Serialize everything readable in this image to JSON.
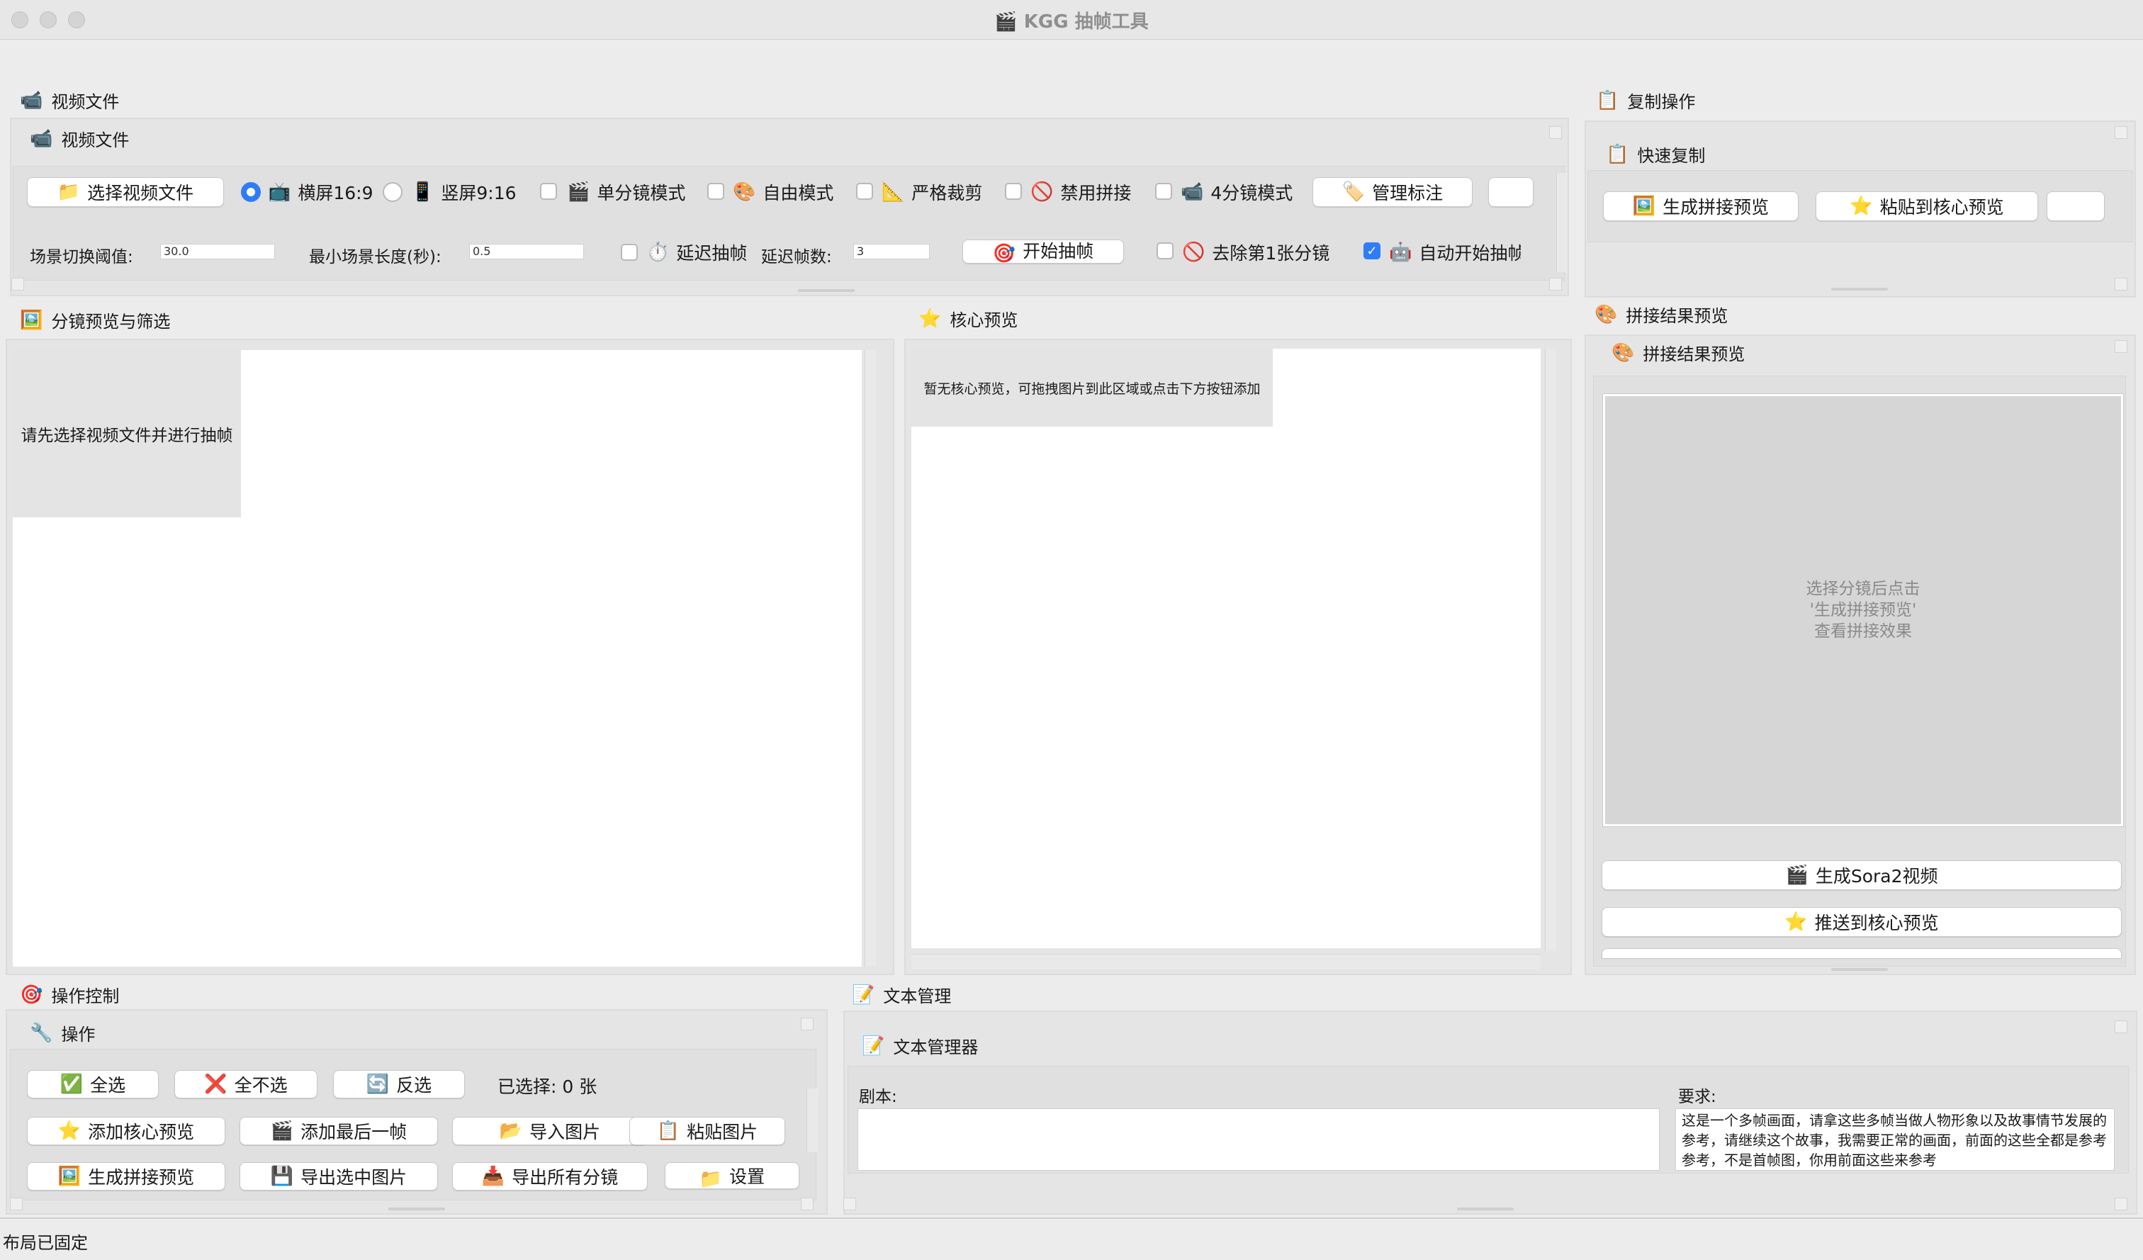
{
  "window": {
    "title": "🎬 KGG 抽帧工具"
  },
  "video_section": {
    "outer_title": "视频文件",
    "inner_title": "视频文件",
    "select_button": "选择视频文件",
    "radio_landscape": "横屏16:9",
    "radio_portrait": "竖屏9:16",
    "single_mode": "单分镜模式",
    "free_mode": "自由模式",
    "strict_crop": "严格裁剪",
    "disable_stitch": "禁用拼接",
    "four_mode": "4分镜模式",
    "manage_tags": "管理标注",
    "threshold_label": "场景切换阈值:",
    "threshold_value": "30.0",
    "min_len_label": "最小场景长度(秒):",
    "min_len_value": "0.5",
    "delay_label": "延迟抽帧",
    "delay_frames_label": "延迟帧数:",
    "delay_frames_value": "3",
    "start_button": "开始抽帧",
    "remove_first": "去除第1张分镜",
    "auto_start": "自动开始抽帧"
  },
  "copy_section": {
    "outer_title": "复制操作",
    "inner_title": "快速复制",
    "gen_preview": "生成拼接预览",
    "paste_core": "粘贴到核心预览"
  },
  "storyboard": {
    "title": "分镜预览与筛选",
    "placeholder": "请先选择视频文件并进行抽帧"
  },
  "core": {
    "title": "核心预览",
    "placeholder": "暂无核心预览，可拖拽图片到此区域或点击下方按钮添加"
  },
  "stitch": {
    "outer_title": "拼接结果预览",
    "inner_title": "拼接结果预览",
    "hint_line1": "选择分镜后点击",
    "hint_line2": "'生成拼接预览'",
    "hint_line3": "查看拼接效果",
    "gen_sora": "生成Sora2视频",
    "push_core": "推送到核心预览"
  },
  "ops": {
    "outer_title": "操作控制",
    "inner_title": "操作",
    "select_all": "全选",
    "select_none": "全不选",
    "invert": "反选",
    "selected_count": "已选择: 0 张",
    "add_core": "添加核心预览",
    "add_last": "添加最后一帧",
    "import_img": "导入图片",
    "paste_img": "粘贴图片",
    "gen_preview": "生成拼接预览",
    "export_selected": "导出选中图片",
    "export_all": "导出所有分镜",
    "settings": "设置"
  },
  "text": {
    "outer_title": "文本管理",
    "inner_title": "文本管理器",
    "script_label": "剧本:",
    "req_label": "要求:",
    "req_value": "这是一个多帧画面，请拿这些多帧当做人物形象以及故事情节发展的参考，请继续这个故事，我需要正常的画面，前面的这些全都是参考参考，不是首帧图，你用前面这些来参考"
  },
  "status": "布局已固定",
  "colors": {
    "accent": "#2f7df6",
    "bg": "#ececec",
    "panel": "#e5e5e5"
  }
}
